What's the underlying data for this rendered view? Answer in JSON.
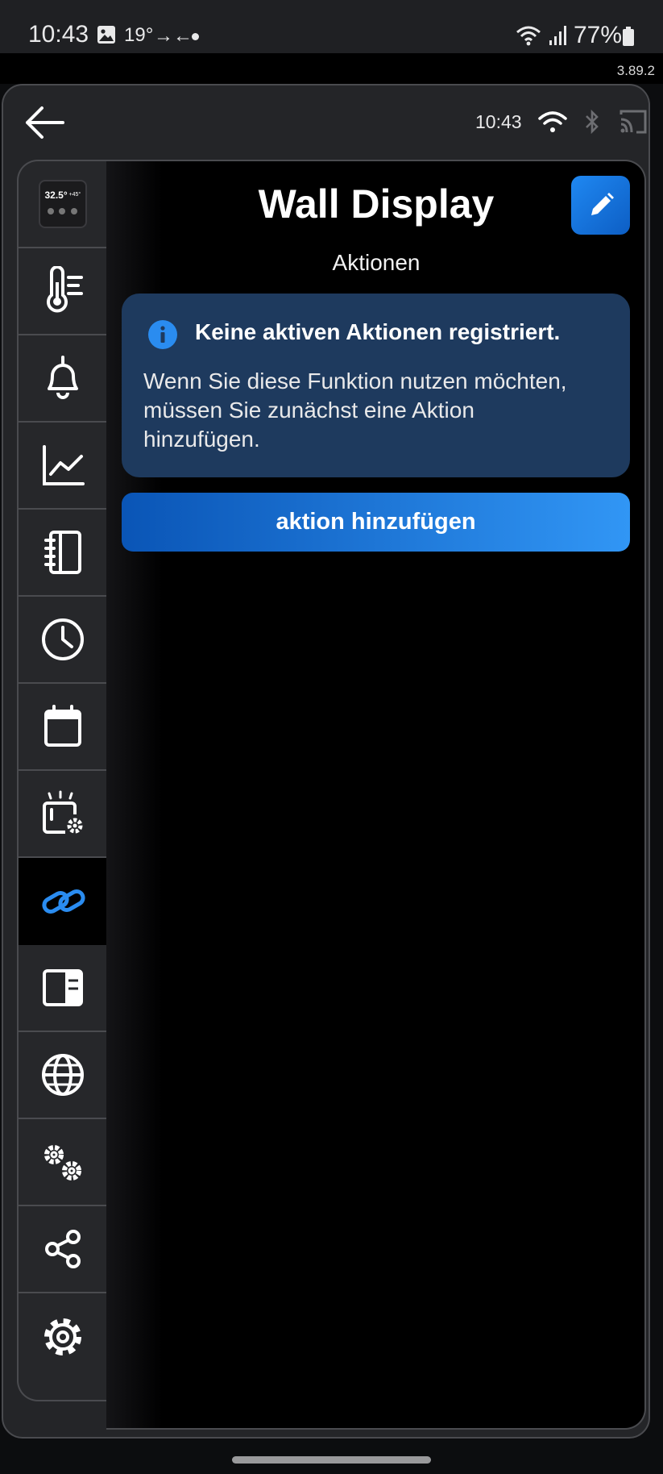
{
  "status_bar": {
    "time": "10:43",
    "temperature": "19°",
    "battery_percent": "77%",
    "icons": [
      "gallery-icon",
      "transfer-arrows-icon",
      "notification-dot",
      "wifi-icon",
      "signal-icon",
      "battery-icon"
    ]
  },
  "version": "3.89.2",
  "header": {
    "time": "10:43",
    "icons": [
      "back-arrow-icon",
      "wifi-icon",
      "bluetooth-icon",
      "cast-icon"
    ]
  },
  "sidebar": {
    "thumbnail": {
      "temperature": "32.5°",
      "secondary": "+45°"
    },
    "items": [
      {
        "icon": "device-thumbnail",
        "active": false
      },
      {
        "icon": "thermometer-icon",
        "active": false
      },
      {
        "icon": "bell-icon",
        "active": false
      },
      {
        "icon": "chart-line-icon",
        "active": false
      },
      {
        "icon": "notebook-icon",
        "active": false
      },
      {
        "icon": "clock-icon",
        "active": false
      },
      {
        "icon": "calendar-icon",
        "active": false
      },
      {
        "icon": "device-settings-icon",
        "active": false
      },
      {
        "icon": "link-icon",
        "active": true
      },
      {
        "icon": "layout-panel-icon",
        "active": false
      },
      {
        "icon": "globe-icon",
        "active": false
      },
      {
        "icon": "gears-icon",
        "active": false
      },
      {
        "icon": "share-icon",
        "active": false
      },
      {
        "icon": "settings-icon",
        "active": false
      }
    ]
  },
  "main": {
    "title": "Wall Display",
    "subtitle": "Aktionen",
    "info": {
      "title": "Keine aktiven Aktionen registriert.",
      "text": "Wenn Sie diese Funktion nutzen möchten, müssen Sie zunächst eine Aktion hinzufügen."
    },
    "add_button_label": "aktion hinzufügen"
  },
  "colors": {
    "accent": "#1f88f2",
    "active_icon": "#2a8cf0",
    "info_bg": "#1e3a5e",
    "background": "#000000",
    "panel": "#242528"
  }
}
